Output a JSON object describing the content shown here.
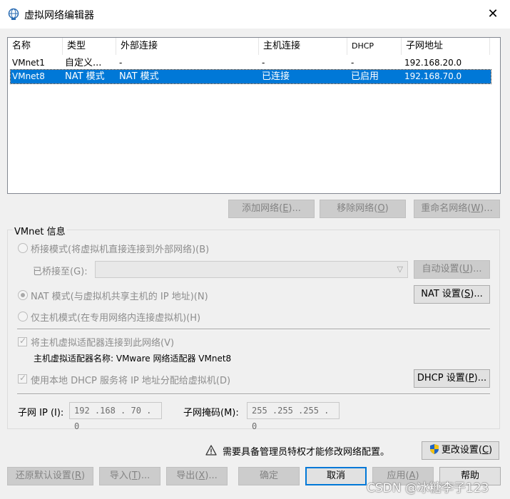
{
  "window": {
    "title": "虚拟网络编辑器",
    "close": "✕"
  },
  "table": {
    "columns": [
      "名称",
      "类型",
      "外部连接",
      "主机连接",
      "DHCP",
      "子网地址"
    ],
    "rows": [
      {
        "name": "VMnet1",
        "type": "自定义...",
        "external": "-",
        "host": "-",
        "dhcp": "-",
        "subnet": "192.168.20.0",
        "selected": false
      },
      {
        "name": "VMnet8",
        "type": "NAT 模式",
        "external": "NAT 模式",
        "host": "已连接",
        "dhcp": "已启用",
        "subnet": "192.168.70.0",
        "selected": true
      }
    ]
  },
  "net_buttons": {
    "add": {
      "text": "添加网络(",
      "key": "E",
      "tail": ")..."
    },
    "remove": {
      "text": "移除网络(",
      "key": "O",
      "tail": ")"
    },
    "rename": {
      "text": "重命名网络(",
      "key": "W",
      "tail": ")..."
    }
  },
  "vmnet_info": {
    "title": "VMnet 信息",
    "bridged": {
      "text": "桥接模式(将虚拟机直接连接到外部网络)(",
      "key": "B",
      "tail": ")"
    },
    "bridged_to": {
      "text": "已桥接至(",
      "key": "G",
      "tail": "):"
    },
    "auto": {
      "text": "自动设置(",
      "key": "U",
      "tail": ")..."
    },
    "nat": {
      "text": "NAT 模式(与虚拟机共享主机的 IP 地址)(",
      "key": "N",
      "tail": ")"
    },
    "nat_settings": {
      "text": "NAT 设置(",
      "key": "S",
      "tail": ")..."
    },
    "hostonly": {
      "text": "仅主机模式(在专用网络内连接虚拟机)(",
      "key": "H",
      "tail": ")"
    },
    "connect_adapter": {
      "text": "将主机虚拟适配器连接到此网络(",
      "key": "V",
      "tail": ")"
    },
    "adapter_name": "主机虚拟适配器名称: VMware 网络适配器 VMnet8",
    "use_dhcp": {
      "text": "使用本地 DHCP 服务将 IP 地址分配给虚拟机(",
      "key": "D",
      "tail": ")"
    },
    "dhcp_settings": {
      "text": "DHCP 设置(",
      "key": "P",
      "tail": ")..."
    },
    "subnet_ip_label": {
      "text": "子网 IP (",
      "key": "I",
      "tail": "):"
    },
    "subnet_ip": "192 .168 . 70 .  0",
    "mask_label": {
      "text": "子网掩码(",
      "key": "M",
      "tail": "):"
    },
    "mask": "255 .255 .255 .  0"
  },
  "admin_notice": "需要具备管理员特权才能修改网络配置。",
  "change_settings": {
    "text": "更改设置(",
    "key": "C",
    "tail": ")"
  },
  "footer": {
    "restore": {
      "text": "还原默认设置(",
      "key": "R",
      "tail": ")"
    },
    "import": {
      "text": "导入(",
      "key": "T",
      "tail": ")..."
    },
    "export": {
      "text": "导出(",
      "key": "X",
      "tail": ")..."
    },
    "ok": "确定",
    "cancel": "取消",
    "apply": {
      "text": "应用(",
      "key": "A",
      "tail": ")"
    },
    "help": "帮助"
  },
  "watermark": "CSDN @冰糖李子123",
  "colors": {
    "selection": "#0078d7",
    "dialog_bg": "#f0f0f0",
    "default_border": "#0078d7"
  }
}
